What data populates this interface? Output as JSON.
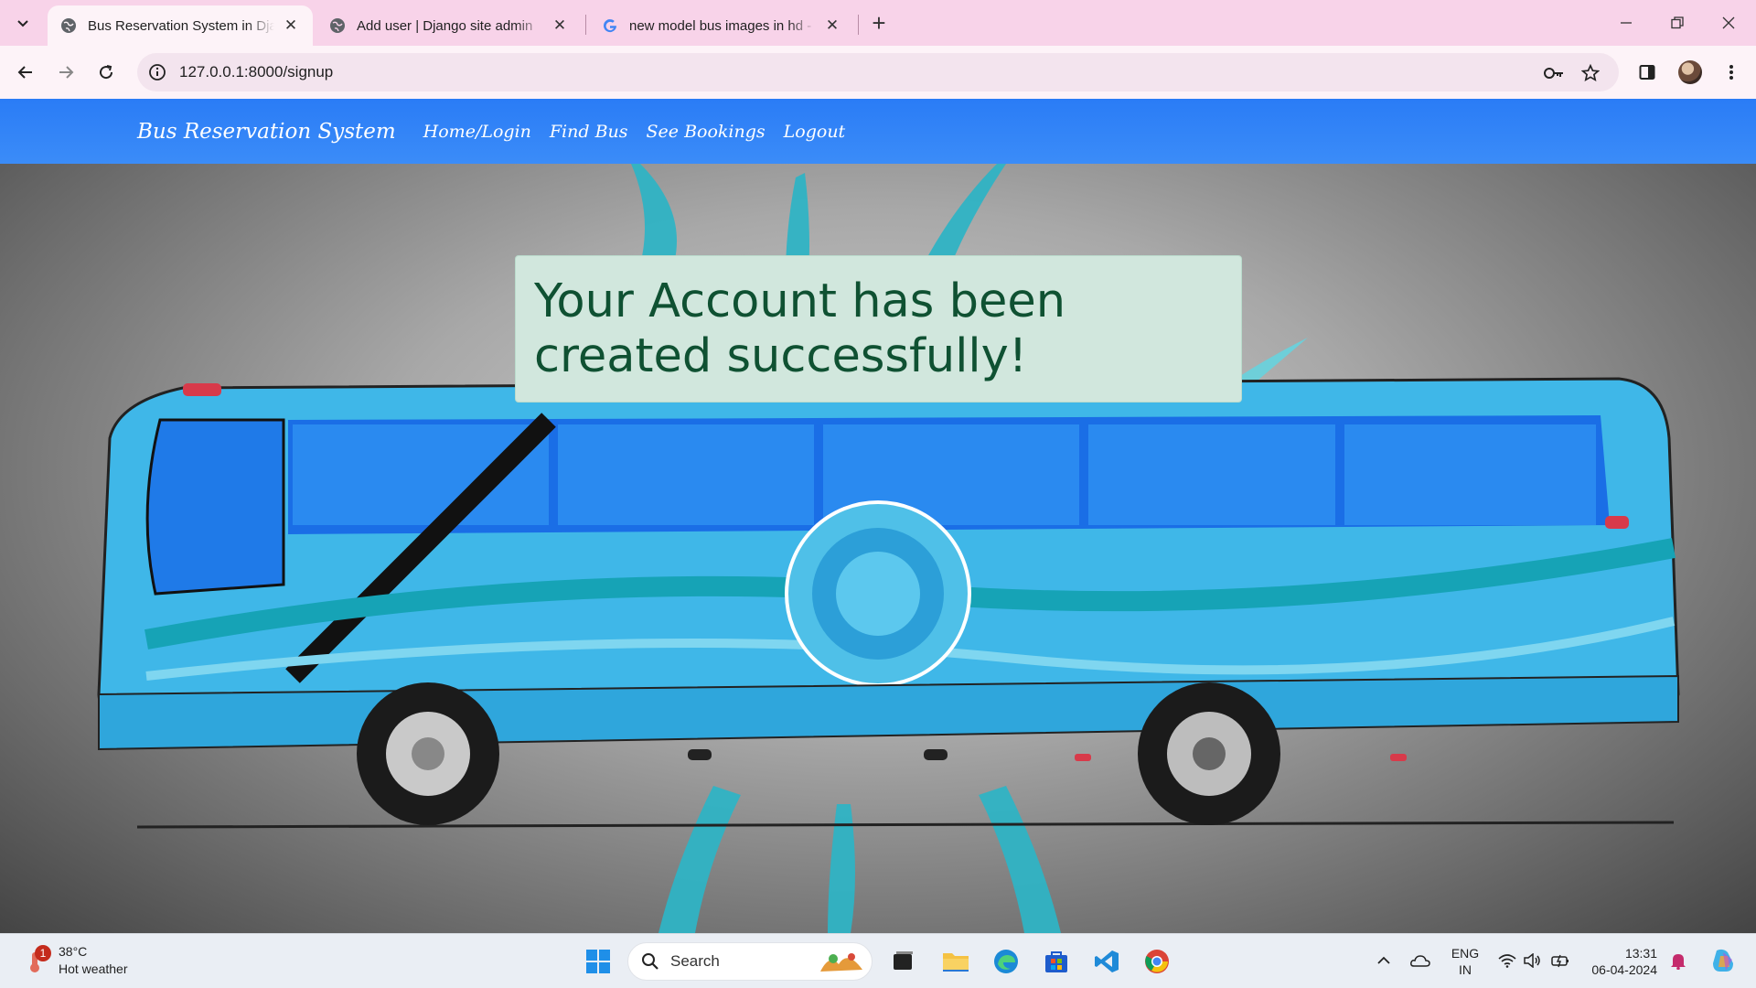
{
  "browser": {
    "tabs": [
      {
        "title": "Bus Reservation System in Djan",
        "active": true,
        "favicon": "globe-icon"
      },
      {
        "title": "Add user | Django site admin",
        "active": false,
        "favicon": "globe-icon"
      },
      {
        "title": "new model bus images in hd - G",
        "active": false,
        "favicon": "google-icon"
      }
    ],
    "url": "127.0.0.1:8000/signup"
  },
  "site": {
    "brand": "Bus Reservation System",
    "nav": [
      "Home/Login",
      "Find Bus",
      "See Bookings",
      "Logout"
    ],
    "alert": {
      "message": "Your Account has been created successfully!"
    }
  },
  "taskbar": {
    "weather": {
      "temp": "38°C",
      "desc": "Hot weather",
      "badge": "1"
    },
    "search_label": "Search",
    "lang": {
      "line1": "ENG",
      "line2": "IN"
    },
    "time": "13:31",
    "date": "06-04-2024"
  },
  "colors": {
    "tabstrip": "#f8d3e9",
    "navbar": "#2f80f7",
    "alert_bg": "#d1e7dd",
    "alert_text": "#0f5132"
  }
}
